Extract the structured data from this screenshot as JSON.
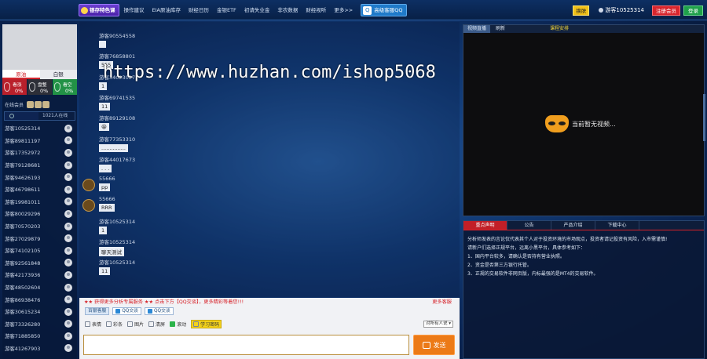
{
  "topbar": {
    "nav": [
      {
        "label": "银存特色课"
      },
      {
        "label": "操作建议"
      },
      {
        "label": "EIA原油库存"
      },
      {
        "label": "财经日历"
      },
      {
        "label": "金银ETF"
      },
      {
        "label": "初请失业金"
      },
      {
        "label": "非农数据"
      },
      {
        "label": "财经视听"
      },
      {
        "label": "更多>>"
      }
    ],
    "qq_label": "高级客服QQ",
    "switch_label": "换肤",
    "user_label": "游客10525314",
    "register_label": "注册会员",
    "login_label": "登录"
  },
  "left": {
    "tabs": [
      "原油",
      "白银"
    ],
    "boxes": [
      {
        "name": "看涨",
        "pct": "0%"
      },
      {
        "name": "盘整",
        "pct": "0%"
      },
      {
        "name": "看空",
        "pct": "0%"
      }
    ],
    "online_label": "在线会员",
    "search_placeholder": "",
    "online_count": "1021人在线",
    "users": [
      "游客10525314",
      "游客89811197",
      "游客17352972",
      "游客79128681",
      "游客94626193",
      "游客46798611",
      "游客19981011",
      "游客80029296",
      "游客70570203",
      "游客27029879",
      "游客74102105",
      "游客92561848",
      "游客42173936",
      "游客48502604",
      "游客86938476",
      "游客30615234",
      "游客73326280",
      "游客71885850",
      "游客41267903"
    ]
  },
  "chat": {
    "watermark": "https://www.huzhan.com/ishop5068",
    "messages": [
      {
        "nick": "游客90554558",
        "text": ""
      },
      {
        "nick": "游客76858801",
        "text": "555"
      },
      {
        "nick": "游客34023027",
        "text": "1"
      },
      {
        "nick": "游客69741535",
        "text": "11"
      },
      {
        "nick": "游客89129108",
        "text": "😀"
      },
      {
        "nick": "游客77353310",
        "text": "..............."
      },
      {
        "nick": "游客44017673",
        "text": ". . ."
      },
      {
        "nick": "55666",
        "text": "pp"
      },
      {
        "nick": "55666",
        "text": "RRR"
      },
      {
        "nick": "游客10525314",
        "text": "1"
      },
      {
        "nick": "游客10525314",
        "text": "聊天测试"
      },
      {
        "nick": "游客10525314",
        "text": "11"
      }
    ]
  },
  "input": {
    "notice": "★★ 获得更多分析专属服务 ★★ 点击下方【QQ交谈】，更多精彩等着您!!!",
    "more_service": "更多客服",
    "services": [
      "百银客服",
      "QQ交谈",
      "QQ交谈"
    ],
    "tools": [
      "表情",
      "彩条",
      "图片",
      "清屏",
      "滚动",
      "学习密码"
    ],
    "select_value": "对所有人说",
    "send_label": "发送"
  },
  "video": {
    "tabs": [
      "视频直播",
      "刷新",
      "课程安排"
    ],
    "no_video": "当前暂无视频..."
  },
  "info": {
    "tabs": [
      "重点声明",
      "公告",
      "产品介绍",
      "下载中心"
    ],
    "lines": [
      "分析师发表的言论仅代表其个人对于投资环境的市场观点，投资者请记投资有风险，入市需谨慎!",
      "请新户们选择正规平台，远离小黑平台，具体参考如下：",
      "1、国内平台较多，请确认是否持有营业执照。",
      "2、资金是否第三方银行托管。",
      "3、正规的交易软件非网页版，内标最强的是MT4的交易软件。"
    ]
  }
}
